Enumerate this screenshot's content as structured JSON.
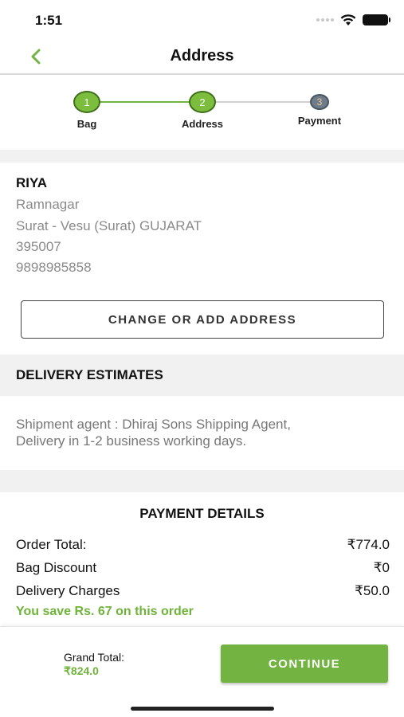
{
  "status_bar": {
    "time": "1:51"
  },
  "nav": {
    "title": "Address"
  },
  "stepper": {
    "steps": [
      {
        "number": "1",
        "label": "Bag",
        "state": "done"
      },
      {
        "number": "2",
        "label": "Address",
        "state": "done"
      },
      {
        "number": "3",
        "label": "Payment",
        "state": "upcoming"
      }
    ]
  },
  "address": {
    "name": "RIYA",
    "line1": "Ramnagar",
    "line2": "Surat - Vesu (Surat)  GUJARAT",
    "pincode": "395007",
    "phone": "9898985858",
    "change_button": "CHANGE OR ADD ADDRESS"
  },
  "delivery": {
    "header": "DELIVERY ESTIMATES",
    "line1": "Shipment agent : Dhiraj Sons Shipping Agent,",
    "line2": "Delivery in 1-2 business working days."
  },
  "payment": {
    "title": "PAYMENT DETAILS",
    "rows": [
      {
        "label": "Order Total:",
        "value": "₹774.0"
      },
      {
        "label": "Bag Discount",
        "value": "₹0"
      },
      {
        "label": "Delivery Charges",
        "value": "₹50.0"
      }
    ],
    "savings": "You save Rs. 67 on this order"
  },
  "footer": {
    "grand_total_label": "Grand Total:",
    "grand_total_value": "₹824.0",
    "continue_label": "CONTINUE"
  },
  "colors": {
    "accent": "#72b342",
    "step_upcoming": "#6f7d8a",
    "muted_text": "#8a8a8a",
    "section_bg": "#f1f1f1"
  }
}
